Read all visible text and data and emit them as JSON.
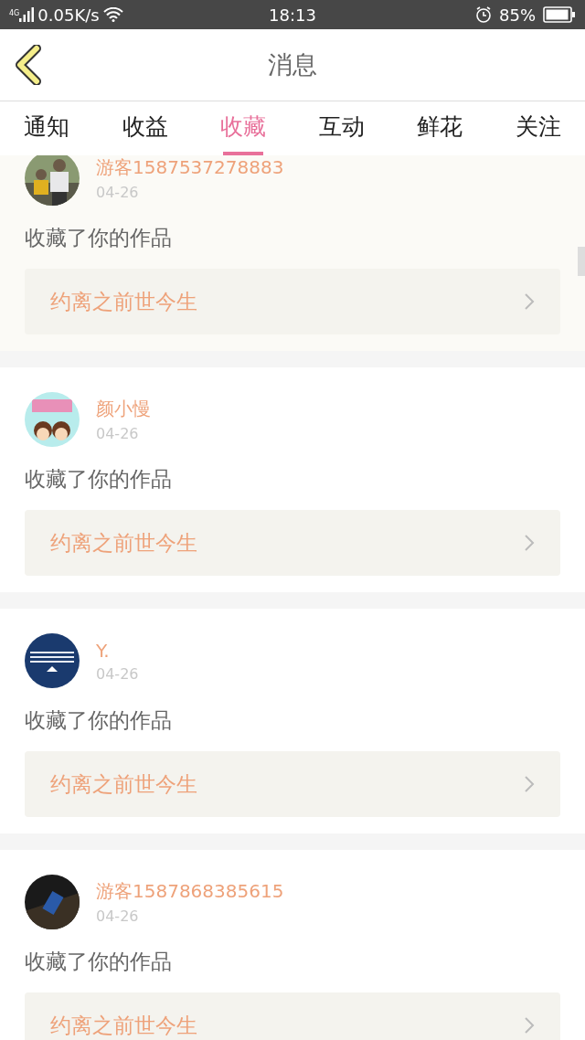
{
  "status_bar": {
    "network": "4G",
    "speed": "0.05K/s",
    "time": "18:13",
    "battery": "85%"
  },
  "header": {
    "title": "消息"
  },
  "tabs": [
    {
      "label": "通知",
      "selected": false
    },
    {
      "label": "收益",
      "selected": false
    },
    {
      "label": "收藏",
      "selected": true
    },
    {
      "label": "互动",
      "selected": false
    },
    {
      "label": "鲜花",
      "selected": false
    },
    {
      "label": "关注",
      "selected": false
    }
  ],
  "messages": [
    {
      "name": "游客1587537278883",
      "date": "04-26",
      "action": "收藏了你的作品",
      "work": "约离之前世今生"
    },
    {
      "name": "颜小慢",
      "date": "04-26",
      "action": "收藏了你的作品",
      "work": "约离之前世今生"
    },
    {
      "name": "Y.",
      "date": "04-26",
      "action": "收藏了你的作品",
      "work": "约离之前世今生"
    },
    {
      "name": "游客1587868385615",
      "date": "04-26",
      "action": "收藏了你的作品",
      "work": "约离之前世今生"
    }
  ]
}
